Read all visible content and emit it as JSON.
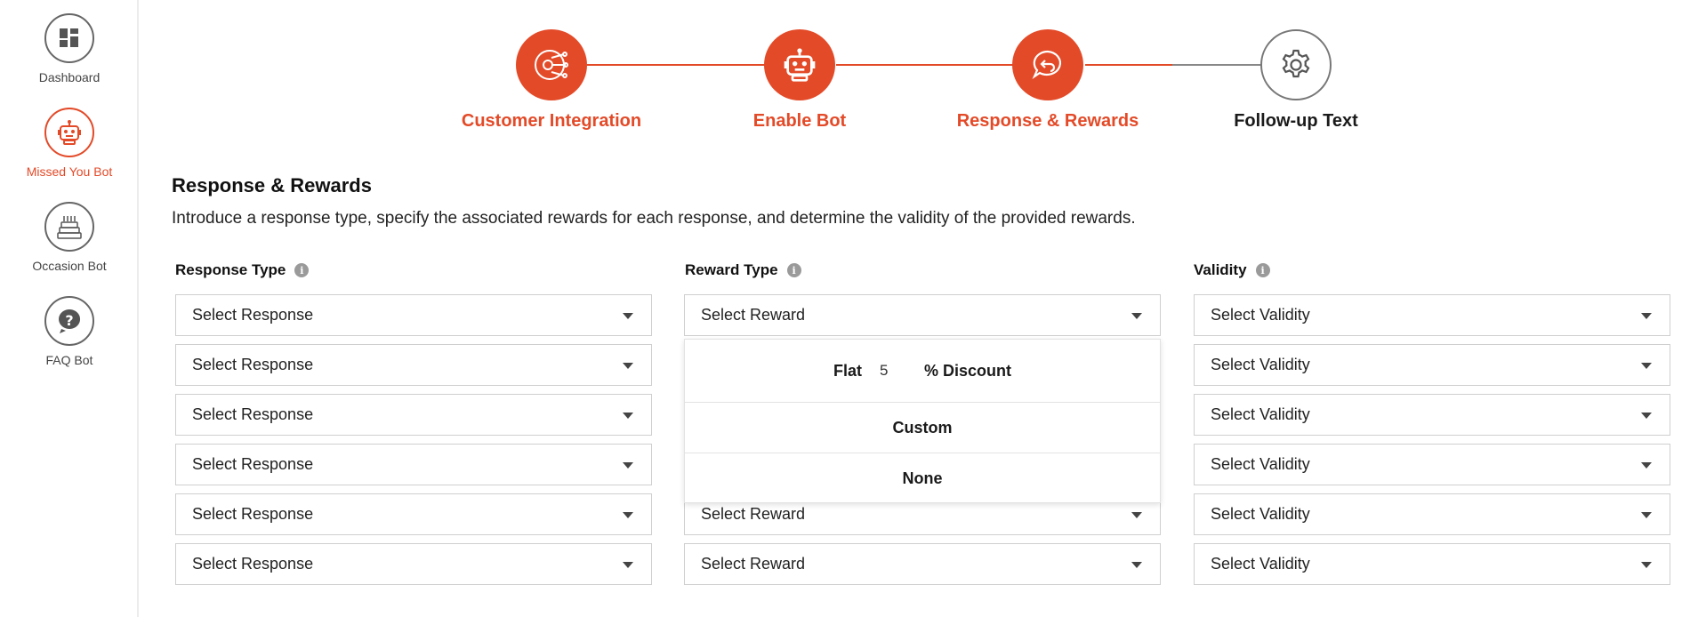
{
  "sidebar": {
    "items": [
      {
        "label": "Dashboard",
        "icon": "dashboard-icon",
        "active": false
      },
      {
        "label": "Missed You Bot",
        "icon": "robot-icon",
        "active": true
      },
      {
        "label": "Occasion Bot",
        "icon": "cake-icon",
        "active": false
      },
      {
        "label": "FAQ Bot",
        "icon": "question-icon",
        "active": false
      }
    ]
  },
  "stepper": {
    "steps": [
      {
        "label": "Customer Integration",
        "icon": "integration-icon",
        "status": "done"
      },
      {
        "label": "Enable Bot",
        "icon": "robot-icon",
        "status": "done"
      },
      {
        "label": "Response & Rewards",
        "icon": "reply-chat-icon",
        "status": "current"
      },
      {
        "label": "Follow-up Text",
        "icon": "gear-icon",
        "status": "pending"
      }
    ]
  },
  "section": {
    "title": "Response & Rewards",
    "description": "Introduce a response type, specify the associated rewards for each response, and determine the validity of the provided rewards."
  },
  "columns": {
    "response": {
      "header": "Response Type",
      "info": "i",
      "placeholder": "Select Response"
    },
    "reward": {
      "header": "Reward Type",
      "info": "i",
      "placeholder": "Select Reward"
    },
    "validity": {
      "header": "Validity",
      "info": "i",
      "placeholder": "Select Validity"
    }
  },
  "rows": [
    {
      "response": "Select Response",
      "reward": "Select Reward",
      "validity": "Select Validity"
    },
    {
      "response": "Select Response",
      "reward": "",
      "validity": "Select Validity"
    },
    {
      "response": "Select Response",
      "reward": "",
      "validity": "Select Validity"
    },
    {
      "response": "Select Response",
      "reward": "",
      "validity": "Select Validity"
    },
    {
      "response": "Select Response",
      "reward": "Select Reward",
      "validity": "Select Validity"
    },
    {
      "response": "Select Response",
      "reward": "Select Reward",
      "validity": "Select Validity"
    }
  ],
  "reward_dropdown": {
    "flat_prefix": "Flat",
    "flat_value": "5",
    "flat_suffix": "% Discount",
    "custom": "Custom",
    "none": "None"
  },
  "colors": {
    "accent": "#e34a28",
    "pending_line": "#777777"
  }
}
